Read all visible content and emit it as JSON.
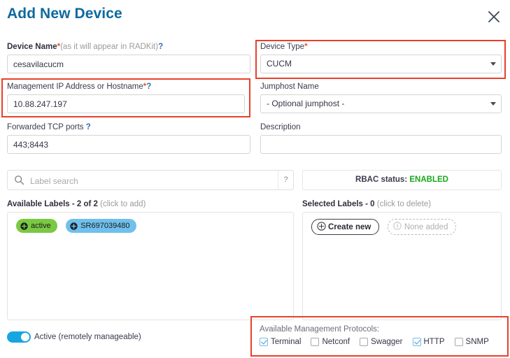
{
  "dialog": {
    "title": "Add New Device",
    "close_icon": "close-icon"
  },
  "form": {
    "device_name": {
      "label_strong": "Device Name",
      "required_mark": "*",
      "label_hint": "(as it will appear in RADKit)",
      "help": "?",
      "value": "cesavilacucm",
      "placeholder": ""
    },
    "management_ip": {
      "label_strong": "Management IP Address or Hostname",
      "required_mark": "*",
      "help": "?",
      "value": "10.88.247.197",
      "placeholder": ""
    },
    "forwarded_ports": {
      "label_strong": "Forwarded TCP ports",
      "help": "?",
      "value": "443;8443",
      "placeholder": ""
    },
    "device_type": {
      "label_strong": "Device Type",
      "required_mark": "*",
      "selected": "CUCM"
    },
    "jumphost": {
      "label_strong": "Jumphost Name",
      "selected": "- Optional jumphost -"
    },
    "description": {
      "label_strong": "Description",
      "value": "",
      "placeholder": ""
    }
  },
  "label_search": {
    "placeholder": "Label search",
    "value": "",
    "search_icon": "search-icon",
    "help": "?"
  },
  "rbac": {
    "label": "RBAC status:",
    "status": "ENABLED",
    "status_color": "#17a81a"
  },
  "available_labels": {
    "heading_main": "Available Labels - ",
    "heading_count": "2 of 2",
    "heading_hint": " (click to add)",
    "chips": [
      {
        "text": "active",
        "color": "#7ac943",
        "icon": "plus-circle-icon"
      },
      {
        "text": "SR697039480",
        "color": "#6fc0ec",
        "icon": "plus-circle-icon"
      }
    ]
  },
  "selected_labels": {
    "heading_main": "Selected Labels - ",
    "heading_count": "0",
    "heading_hint": " (click to delete)",
    "create_new_label": "Create new",
    "create_new_icon": "plus-circle-icon",
    "none_added_label": "None added",
    "none_added_icon": "info-circle-icon"
  },
  "active_toggle": {
    "label": "Active (remotely manageable)",
    "on": true,
    "color": "#18a6e0"
  },
  "protocols": {
    "title": "Available Management Protocols:",
    "items": [
      {
        "label": "Terminal",
        "checked": true
      },
      {
        "label": "Netconf",
        "checked": false
      },
      {
        "label": "Swagger",
        "checked": false
      },
      {
        "label": "HTTP",
        "checked": true
      },
      {
        "label": "SNMP",
        "checked": false
      }
    ]
  },
  "annotations": {
    "color": "#e8402a",
    "boxes": [
      "management-ip-field",
      "device-type-field",
      "management-protocols"
    ]
  }
}
